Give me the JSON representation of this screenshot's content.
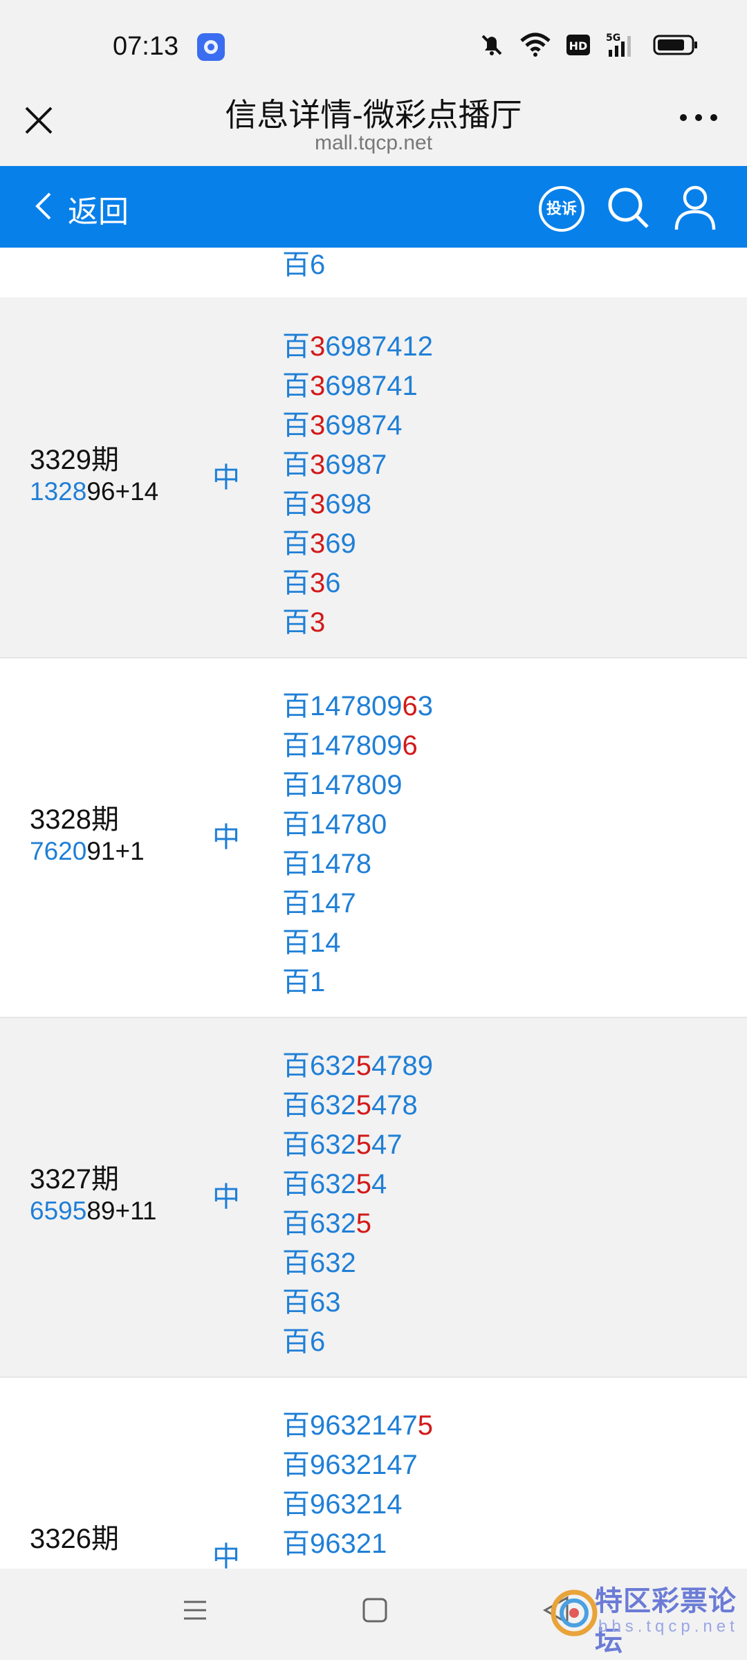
{
  "status_bar": {
    "time": "07:13"
  },
  "titlebar": {
    "title": "信息详情-微彩点播厅",
    "url": "mall.tqcp.net"
  },
  "navbar": {
    "back_label": "返回",
    "complain_label": "投诉"
  },
  "prefix": "百",
  "partial_top": [
    "6"
  ],
  "sections": [
    {
      "period": "3329期",
      "sub_blue": "1328",
      "sub_rest": "96+14",
      "zhong": "中",
      "lines": [
        [
          "",
          "3",
          "6987412"
        ],
        [
          "",
          "3",
          "698741"
        ],
        [
          "",
          "3",
          "69874"
        ],
        [
          "",
          "3",
          "6987"
        ],
        [
          "",
          "3",
          "698"
        ],
        [
          "",
          "3",
          "69"
        ],
        [
          "",
          "3",
          "6"
        ],
        [
          "",
          "3",
          ""
        ]
      ]
    },
    {
      "period": "3328期",
      "sub_blue": "7620",
      "sub_rest": "91+1",
      "zhong": "中",
      "lines": [
        [
          "147809",
          "6",
          "3"
        ],
        [
          "147809",
          "6",
          ""
        ],
        [
          "147809",
          "",
          ""
        ],
        [
          "14780",
          "",
          ""
        ],
        [
          "1478",
          "",
          ""
        ],
        [
          "147",
          "",
          ""
        ],
        [
          "14",
          "",
          ""
        ],
        [
          "1",
          "",
          ""
        ]
      ]
    },
    {
      "period": "3327期",
      "sub_blue": "6595",
      "sub_rest": "89+11",
      "zhong": "中",
      "lines": [
        [
          "632",
          "5",
          "4789"
        ],
        [
          "632",
          "5",
          "478"
        ],
        [
          "632",
          "5",
          "47"
        ],
        [
          "632",
          "5",
          "4"
        ],
        [
          "632",
          "5",
          ""
        ],
        [
          "632",
          "",
          ""
        ],
        [
          "63",
          "",
          ""
        ],
        [
          "6",
          "",
          ""
        ]
      ]
    },
    {
      "period": "3326期",
      "sub_blue": "",
      "sub_rest": "",
      "zhong": "中",
      "lines": [
        [
          "9632147",
          "5",
          ""
        ],
        [
          "9632147",
          "",
          ""
        ],
        [
          "963214",
          "",
          ""
        ],
        [
          "96321",
          "",
          ""
        ]
      ]
    }
  ],
  "watermark": {
    "text": "特区彩票论坛",
    "sub": "bbs.tqcp.net"
  }
}
